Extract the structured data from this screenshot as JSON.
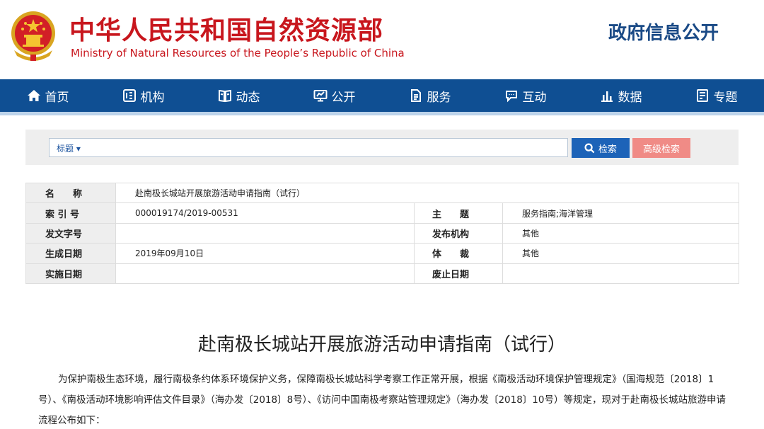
{
  "header": {
    "title_cn": "中华人民共和国自然资源部",
    "title_en": "Ministry of Natural Resources of the People’s Republic of China",
    "right_title": "政府信息公开"
  },
  "nav": {
    "items": [
      {
        "label": "首页",
        "icon": "home-icon"
      },
      {
        "label": "机构",
        "icon": "organization-icon"
      },
      {
        "label": "动态",
        "icon": "news-book-icon"
      },
      {
        "label": "公开",
        "icon": "monitor-icon"
      },
      {
        "label": "服务",
        "icon": "service-doc-icon"
      },
      {
        "label": "互动",
        "icon": "chat-icon"
      },
      {
        "label": "数据",
        "icon": "bar-chart-icon"
      },
      {
        "label": "专题",
        "icon": "topic-icon"
      }
    ]
  },
  "search": {
    "type_label": "标题 ▾",
    "value": "",
    "search_button": "检索",
    "advanced_button": "高级检索"
  },
  "info": {
    "name_label": "名　　称",
    "name_value": "赴南极长城站开展旅游活动申请指南（试行）",
    "index_label": "索 引 号",
    "index_value": "000019174/2019-00531",
    "subject_label": "主　　题",
    "subject_value": "服务指南;海洋管理",
    "doc_no_label": "发文字号",
    "doc_no_value": "",
    "publisher_label": "发布机构",
    "publisher_value": "其他",
    "date_label": "生成日期",
    "date_value": "2019年09月10日",
    "genre_label": "体　　裁",
    "genre_value": "其他",
    "effective_label": "实施日期",
    "effective_value": "",
    "expire_label": "废止日期",
    "expire_value": ""
  },
  "article": {
    "title": "赴南极长城站开展旅游活动申请指南（试行）",
    "paragraph": "为保护南极生态环境，履行南极条约体系环境保护义务，保障南极长城站科学考察工作正常开展，根据《南极活动环境保护管理规定》（国海规范〔2018〕1号）、《南极活动环境影响评估文件目录》（海办发〔2018〕8号）、《访问中国南极考察站管理规定》（海办发〔2018〕10号）等规定，现对于赴南极长城站旅游申请流程公布如下："
  },
  "colors": {
    "brand_red": "#c8161d",
    "nav_blue": "#0f4f93",
    "search_blue": "#1d63b8",
    "advanced_pink": "#f08b86"
  }
}
